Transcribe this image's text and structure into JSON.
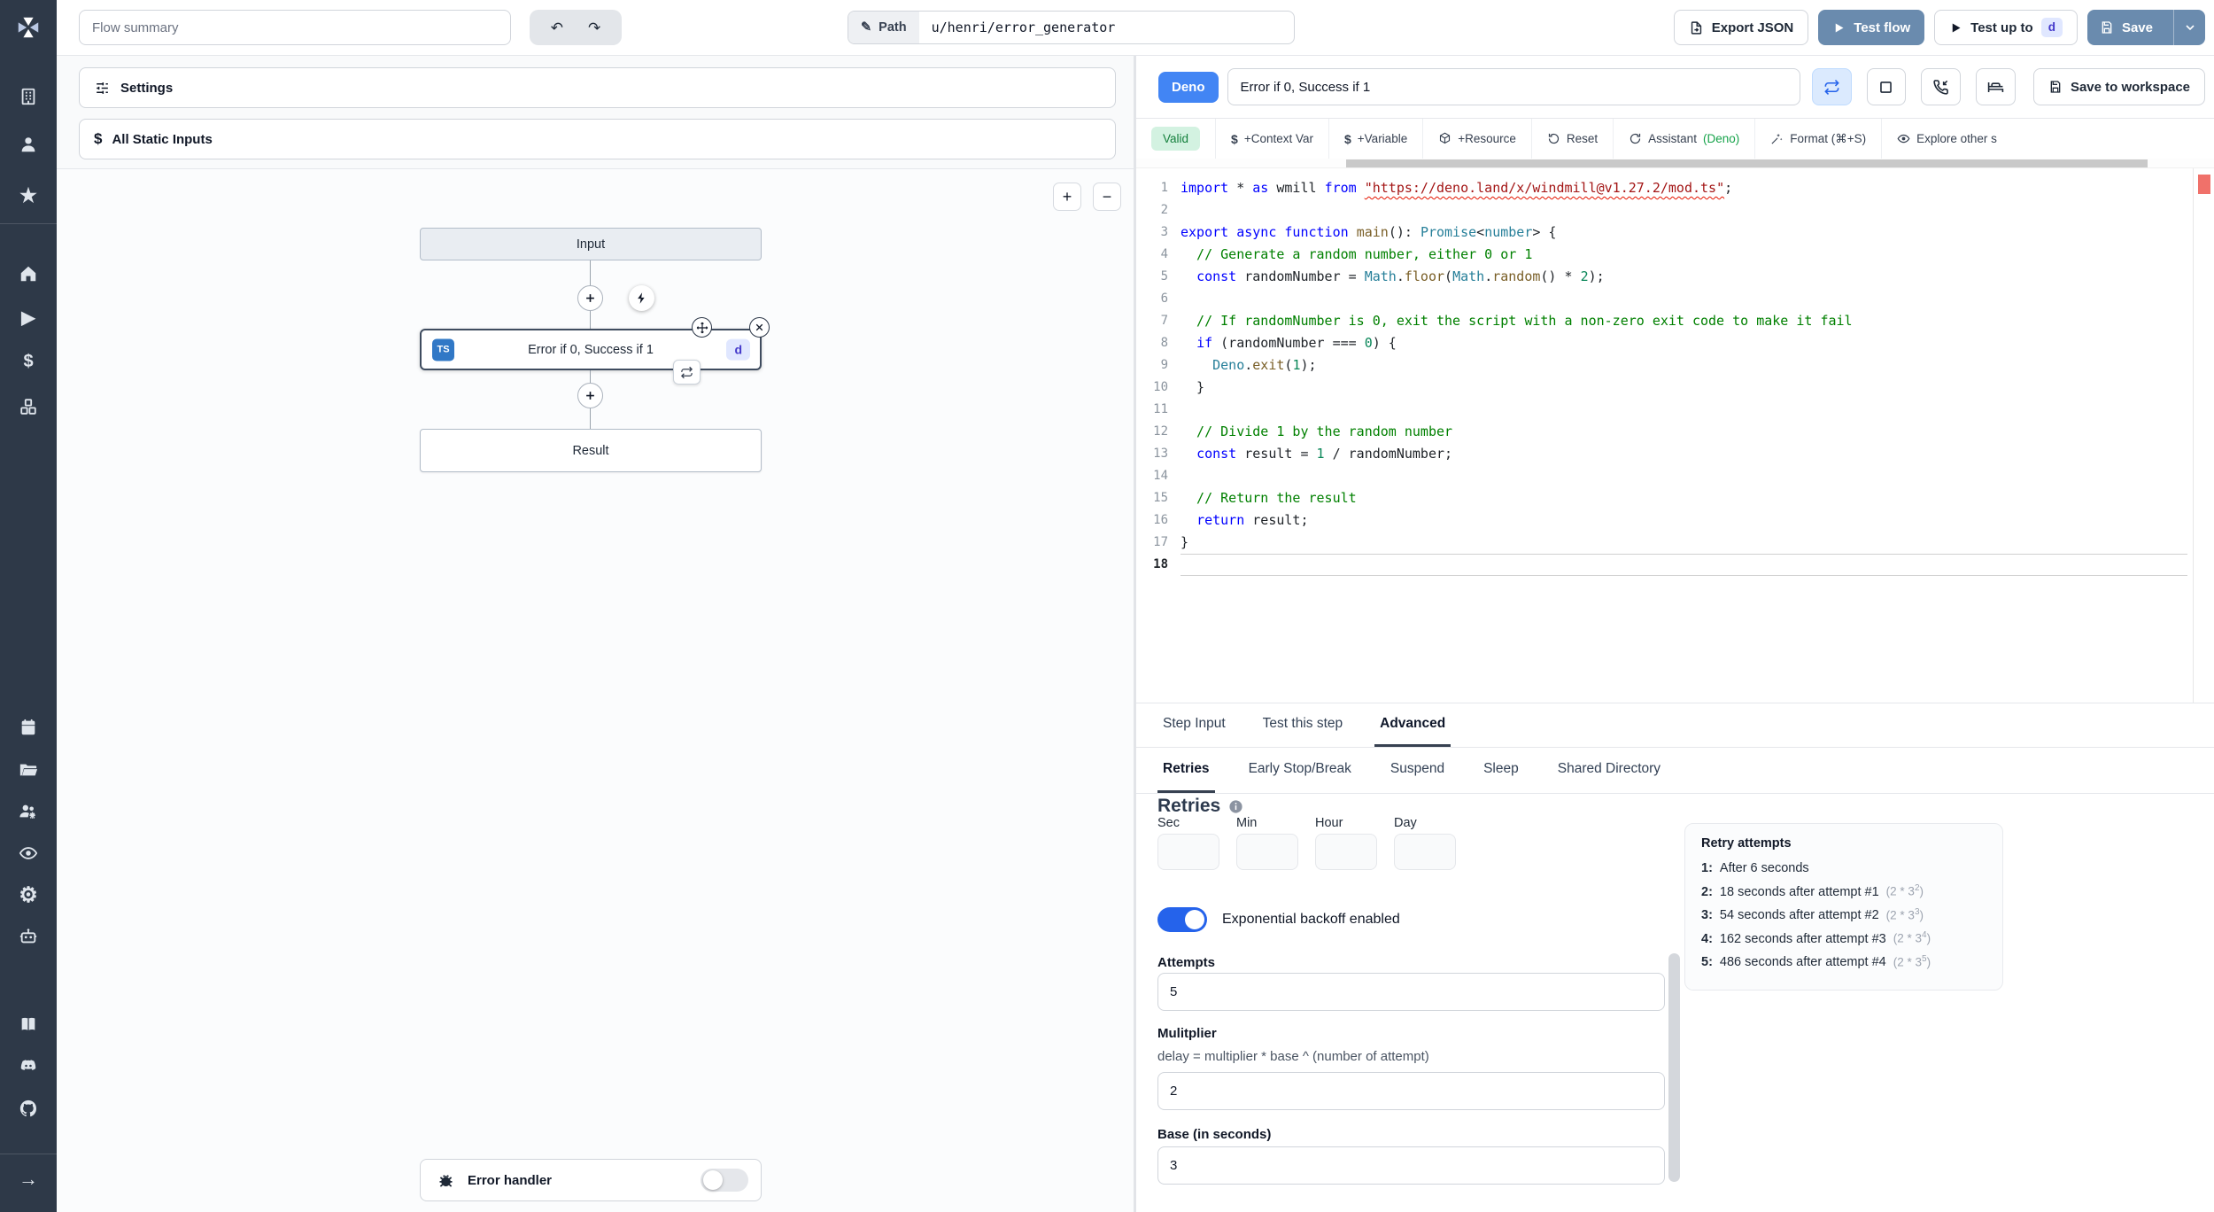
{
  "icons": {
    "undo": "↶",
    "redo": "↷",
    "pencil": "✎",
    "star": "★",
    "play": "▶",
    "dollar": "$",
    "gear": "⚙",
    "arrow_right": "→",
    "zoom_in": "+",
    "zoom_out": "−"
  },
  "topbar": {
    "flow_summary_placeholder": "Flow summary",
    "path_label": "Path",
    "path_value": "u/henri/error_generator",
    "export_json": "Export JSON",
    "test_flow": "Test flow",
    "test_up_to": "Test up to",
    "test_up_to_badge": "d",
    "save": "Save"
  },
  "flow_panel": {
    "settings": "Settings",
    "all_static_inputs": "All Static Inputs",
    "input_node": "Input",
    "step_title": "Error if 0, Success if 1",
    "step_lang_badge": "TS",
    "step_id_badge": "d",
    "result_node": "Result",
    "error_handler": "Error handler"
  },
  "editor_header": {
    "lang_badge": "Deno",
    "title_value": "Error if 0, Success if 1",
    "save_to_workspace": "Save to workspace"
  },
  "editor_toolbar": {
    "valid": "Valid",
    "context_var": "+Context Var",
    "variable": "+Variable",
    "resource": "+Resource",
    "reset": "Reset",
    "assistant": "Assistant",
    "assistant_lang": "(Deno)",
    "format": "Format (⌘+S)",
    "explore": "Explore other s"
  },
  "editor": {
    "current_line": 18,
    "lines": [
      [
        [
          "kw",
          "import"
        ],
        [
          "pl",
          " * "
        ],
        [
          "kw",
          "as"
        ],
        [
          "pl",
          " wmill "
        ],
        [
          "kw",
          "from"
        ],
        [
          "pl",
          " "
        ],
        [
          "strerr",
          "\"https://deno.land/x/windmill@v1.27.2/mod.ts\""
        ],
        [
          "pl",
          ";"
        ]
      ],
      [],
      [
        [
          "kw",
          "export"
        ],
        [
          "pl",
          " "
        ],
        [
          "kw",
          "async"
        ],
        [
          "pl",
          " "
        ],
        [
          "kw",
          "function"
        ],
        [
          "pl",
          " "
        ],
        [
          "fn",
          "main"
        ],
        [
          "pl",
          "(): "
        ],
        [
          "cls",
          "Promise"
        ],
        [
          "pl",
          "<"
        ],
        [
          "cls",
          "number"
        ],
        [
          "pl",
          "> {"
        ]
      ],
      [
        [
          "com",
          "  // Generate a random number, either 0 or 1"
        ]
      ],
      [
        [
          "pl",
          "  "
        ],
        [
          "kw",
          "const"
        ],
        [
          "pl",
          " randomNumber = "
        ],
        [
          "cls",
          "Math"
        ],
        [
          "pl",
          "."
        ],
        [
          "fn",
          "floor"
        ],
        [
          "pl",
          "("
        ],
        [
          "cls",
          "Math"
        ],
        [
          "pl",
          "."
        ],
        [
          "fn",
          "random"
        ],
        [
          "pl",
          "() * "
        ],
        [
          "num",
          "2"
        ],
        [
          "pl",
          ");"
        ]
      ],
      [],
      [
        [
          "com",
          "  // If randomNumber is 0, exit the script with a non-zero exit code to make it fail"
        ]
      ],
      [
        [
          "pl",
          "  "
        ],
        [
          "kw",
          "if"
        ],
        [
          "pl",
          " (randomNumber === "
        ],
        [
          "num",
          "0"
        ],
        [
          "pl",
          ") {"
        ]
      ],
      [
        [
          "pl",
          "    "
        ],
        [
          "cls",
          "Deno"
        ],
        [
          "pl",
          "."
        ],
        [
          "fn",
          "exit"
        ],
        [
          "pl",
          "("
        ],
        [
          "num",
          "1"
        ],
        [
          "pl",
          ");"
        ]
      ],
      [
        [
          "pl",
          "  }"
        ]
      ],
      [],
      [
        [
          "com",
          "  // Divide 1 by the random number"
        ]
      ],
      [
        [
          "pl",
          "  "
        ],
        [
          "kw",
          "const"
        ],
        [
          "pl",
          " result = "
        ],
        [
          "num",
          "1"
        ],
        [
          "pl",
          " / randomNumber;"
        ]
      ],
      [],
      [
        [
          "com",
          "  // Return the result"
        ]
      ],
      [
        [
          "pl",
          "  "
        ],
        [
          "kw",
          "return"
        ],
        [
          "pl",
          " result;"
        ]
      ],
      [
        [
          "pl",
          "}"
        ]
      ],
      []
    ]
  },
  "bottom_tabs": [
    "Step Input",
    "Test this step",
    "Advanced"
  ],
  "advanced_tabs": [
    "Retries",
    "Early Stop/Break",
    "Suspend",
    "Sleep",
    "Shared Directory"
  ],
  "retries": {
    "heading": "Retries",
    "time_labels": [
      "Sec",
      "Min",
      "Hour",
      "Day"
    ],
    "backoff_label": "Exponential backoff enabled",
    "attempts_label": "Attempts",
    "attempts_value": "5",
    "multiplier_label": "Mulitplier",
    "multiplier_help": "delay = multiplier * base ^ (number of attempt)",
    "multiplier_value": "2",
    "base_label": "Base (in seconds)",
    "base_value": "3",
    "retry_attempts": {
      "title": "Retry attempts",
      "items": [
        {
          "n": "1:",
          "text": "After 6 seconds"
        },
        {
          "n": "2:",
          "text": "18 seconds after attempt #1",
          "f_pre": "(2 * 3",
          "f_exp": "2",
          "f_post": ")"
        },
        {
          "n": "3:",
          "text": "54 seconds after attempt #2",
          "f_pre": "(2 * 3",
          "f_exp": "3",
          "f_post": ")"
        },
        {
          "n": "4:",
          "text": "162 seconds after attempt #3",
          "f_pre": "(2 * 3",
          "f_exp": "4",
          "f_post": ")"
        },
        {
          "n": "5:",
          "text": "486 seconds after attempt #4",
          "f_pre": "(2 * 3",
          "f_exp": "5",
          "f_post": ")"
        }
      ]
    }
  },
  "colors": {
    "sidebar_bg": "#2e3948",
    "primary_button": "#6a8bae",
    "deno_badge": "#4285f4",
    "valid_bg": "#d3f2e1",
    "valid_text": "#15803d",
    "toggle_on": "#2563eb",
    "indigo_badge_bg": "#e0e7ff",
    "indigo_badge_text": "#4338ca",
    "ts_badge": "#3178c6"
  }
}
